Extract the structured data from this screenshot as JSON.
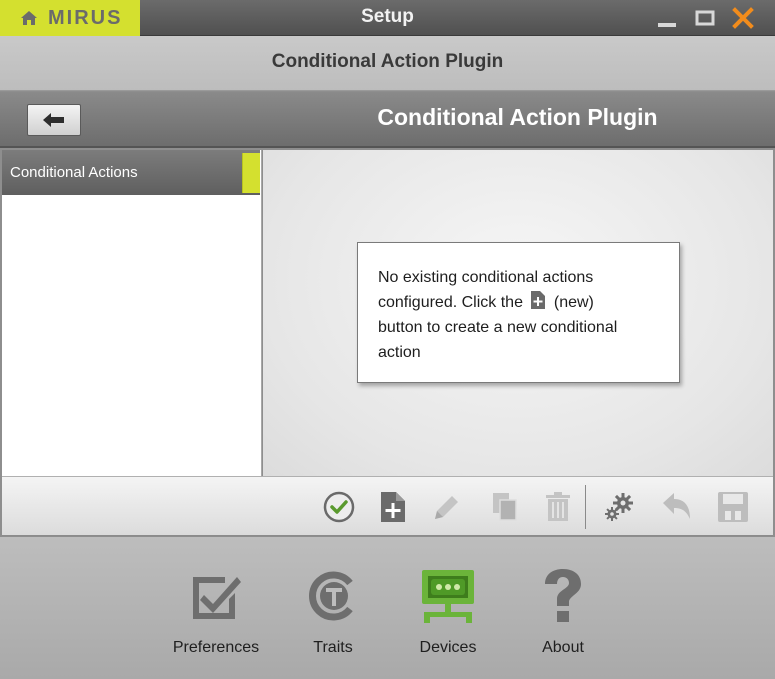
{
  "window": {
    "brand": "MIRUS",
    "title": "Setup",
    "controls": [
      "minimize-icon",
      "maximize-icon",
      "close-icon"
    ],
    "close_color": "#f28c1c"
  },
  "subheader": {
    "title": "Conditional Action Plugin"
  },
  "plugin_header": {
    "title": "Conditional Action Plugin",
    "back_icon": "arrow-left-icon"
  },
  "sidebar": {
    "items": [
      {
        "label": "Conditional Actions",
        "selected": true
      }
    ]
  },
  "message": {
    "line1": "No existing conditional actions",
    "line2_before": "configured.  Click the",
    "line2_after": "(new)",
    "line3": "button to create a new conditional",
    "line4": "action"
  },
  "toolbar": {
    "buttons": [
      {
        "name": "ok-icon",
        "enabled": true
      },
      {
        "name": "new-document-icon",
        "enabled": true
      },
      {
        "name": "edit-pencil-icon",
        "enabled": false
      },
      {
        "name": "copy-icon",
        "enabled": false
      },
      {
        "name": "trash-icon",
        "enabled": false
      },
      {
        "name": "settings-gears-icon",
        "enabled": true
      },
      {
        "name": "undo-icon",
        "enabled": false
      },
      {
        "name": "save-floppy-icon",
        "enabled": false
      }
    ]
  },
  "nav": {
    "items": [
      {
        "label": "Preferences",
        "icon": "checkbox-icon"
      },
      {
        "label": "Traits",
        "icon": "traits-icon"
      },
      {
        "label": "Devices",
        "icon": "devices-monitor-icon",
        "active": true
      },
      {
        "label": "About",
        "icon": "question-mark-icon"
      }
    ]
  },
  "colors": {
    "accent": "#d4e02f",
    "active_green": "#6bb43a",
    "ok_green": "#5a9a2e"
  }
}
